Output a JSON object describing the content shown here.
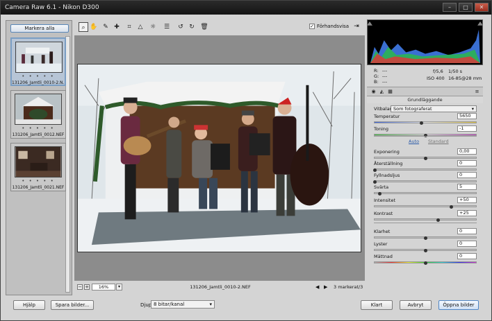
{
  "window": {
    "title": "Camera Raw 6.1  -  Nikon D300"
  },
  "filmstrip": {
    "select_all": "Markera alla",
    "thumbs": [
      {
        "name": "131206_Jamtli_0010-2.N...",
        "rating": "• • • • •",
        "selected": true
      },
      {
        "name": "131206_Jamtli_0012.NEF",
        "rating": "• • • • •",
        "selected": false
      },
      {
        "name": "131206_Jamtli_0021.NEF",
        "rating": "• • • • •",
        "selected": false
      }
    ]
  },
  "toolbar": {
    "tools": [
      "zoom-icon",
      "hand-icon",
      "white-balance-icon",
      "color-sampler-icon",
      "crop-icon",
      "straighten-icon",
      "spot-removal-icon",
      "list-icon",
      "rotate-left-icon",
      "rotate-right-icon",
      "trash-icon"
    ],
    "preview_label": "Förhandsvisa",
    "preview_checked": "✓"
  },
  "status": {
    "zoom": "16%",
    "filename": "131206_Jamtli_0010-2.NEF",
    "selected_count": "3 markerat/3"
  },
  "camera_info": {
    "r_label": "R:",
    "g_label": "G:",
    "b_label": "B:",
    "r": "---",
    "g": "---",
    "b": "---",
    "aperture": "f/5,6",
    "shutter": "1/50 s",
    "iso": "ISO 400",
    "lens": "16-85@28 mm"
  },
  "panel": {
    "title": "Grundläggande",
    "wb_label": "Vitbalans:",
    "wb_value": "Som fotograferat",
    "auto": "Auto",
    "standard": "Standard",
    "sliders": [
      {
        "label": "Temperatur",
        "value": "5650",
        "pos": 0.46
      },
      {
        "label": "Toning",
        "value": "-1",
        "pos": 0.5
      },
      {
        "label": "Exponering",
        "value": "0,00",
        "pos": 0.5
      },
      {
        "label": "Återställning",
        "value": "0",
        "pos": 0.0
      },
      {
        "label": "Fyllnadsljus",
        "value": "0",
        "pos": 0.0
      },
      {
        "label": "Svärta",
        "value": "5",
        "pos": 0.05
      },
      {
        "label": "Intensitet",
        "value": "+50",
        "pos": 0.75
      },
      {
        "label": "Kontrast",
        "value": "+25",
        "pos": 0.62
      },
      {
        "label": "Klarhet",
        "value": "0",
        "pos": 0.5
      },
      {
        "label": "Lyster",
        "value": "0",
        "pos": 0.5
      },
      {
        "label": "Mättnad",
        "value": "0",
        "pos": 0.5
      }
    ]
  },
  "bottom": {
    "help": "Hjälp",
    "save": "Spara bilder...",
    "depth_label": "Djup:",
    "depth_value": "8 bitar/kanal",
    "done": "Klart",
    "cancel": "Avbryt",
    "open": "Öppna bilder"
  }
}
